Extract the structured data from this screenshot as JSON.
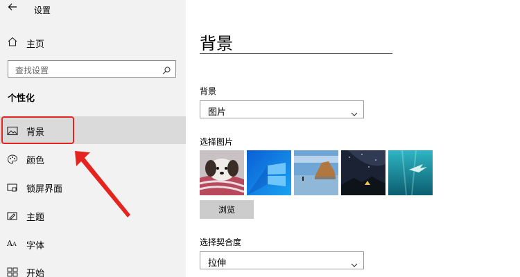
{
  "app": {
    "title": "设置",
    "back_icon": "back-arrow-icon"
  },
  "sidebar": {
    "home_label": "主页",
    "search_placeholder": "查找设置",
    "section_heading": "个性化",
    "items": [
      {
        "label": "背景",
        "icon": "picture-icon",
        "active": true
      },
      {
        "label": "颜色",
        "icon": "palette-icon",
        "active": false
      },
      {
        "label": "锁屏界面",
        "icon": "lock-screen-icon",
        "active": false
      },
      {
        "label": "主题",
        "icon": "theme-icon",
        "active": false
      },
      {
        "label": "字体",
        "icon": "font-icon",
        "active": false
      },
      {
        "label": "开始",
        "icon": "start-icon",
        "active": false
      }
    ]
  },
  "main": {
    "title": "背景",
    "background_label": "背景",
    "background_value": "图片",
    "choose_picture_label": "选择图片",
    "browse_label": "浏览",
    "fit_label": "选择契合度",
    "fit_value": "拉伸"
  },
  "colors": {
    "highlight": "#e5241f",
    "sidebar_bg": "#f2f2f2",
    "active_bg": "#dadada"
  }
}
